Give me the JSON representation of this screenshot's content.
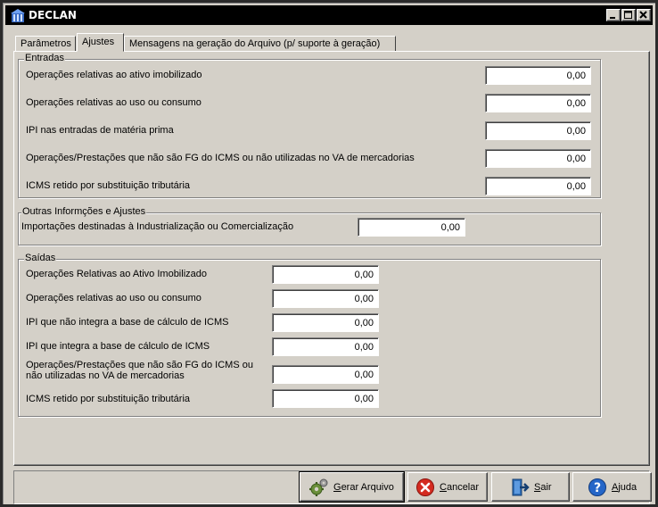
{
  "window": {
    "title": "DECLAN"
  },
  "tabs": [
    {
      "label": "Parâmetros"
    },
    {
      "label": "Ajustes"
    },
    {
      "label": "Mensagens na geração do Arquivo (p/ suporte à geração)"
    }
  ],
  "entradas": {
    "title": "Entradas",
    "rows": [
      {
        "label": "Operações relativas ao ativo imobilizado",
        "value": "0,00"
      },
      {
        "label": "Operações relativas ao uso ou consumo",
        "value": "0,00"
      },
      {
        "label": "IPI nas entradas de matéria prima",
        "value": "0,00"
      },
      {
        "label": "Operações/Prestações que não são FG do ICMS ou não utilizadas no VA de mercadorias",
        "value": "0,00"
      },
      {
        "label": "ICMS retido por substituição tributária",
        "value": "0,00"
      }
    ]
  },
  "outras": {
    "title": "Outras Informções e Ajustes",
    "rows": [
      {
        "label": "Importações destinadas à Industrialização ou Comercialização",
        "value": "0,00"
      }
    ]
  },
  "saidas": {
    "title": "Saídas",
    "rows": [
      {
        "label": "Operações Relativas ao Ativo Imobilizado",
        "value": "0,00"
      },
      {
        "label": "Operações relativas ao uso ou consumo",
        "value": "0,00"
      },
      {
        "label": "IPI que não integra a base de cálculo de ICMS",
        "value": "0,00"
      },
      {
        "label": "IPI que integra a base de cálculo de ICMS",
        "value": "0,00"
      },
      {
        "label_line1": "Operações/Prestações que não são FG do ICMS ou",
        "label_line2": "não utilizadas no VA de mercadorias",
        "value": "0,00"
      },
      {
        "label": "ICMS retido por substituição tributária",
        "value": "0,00"
      }
    ]
  },
  "buttons": {
    "gerar": {
      "label": "Gerar Arquivo",
      "icon": "gears-icon"
    },
    "cancelar": {
      "label": "Cancelar",
      "icon": "cancel-icon"
    },
    "sair": {
      "label": "Sair",
      "icon": "exit-door-icon"
    },
    "ajuda": {
      "label": "Ajuda",
      "icon": "help-icon"
    }
  }
}
